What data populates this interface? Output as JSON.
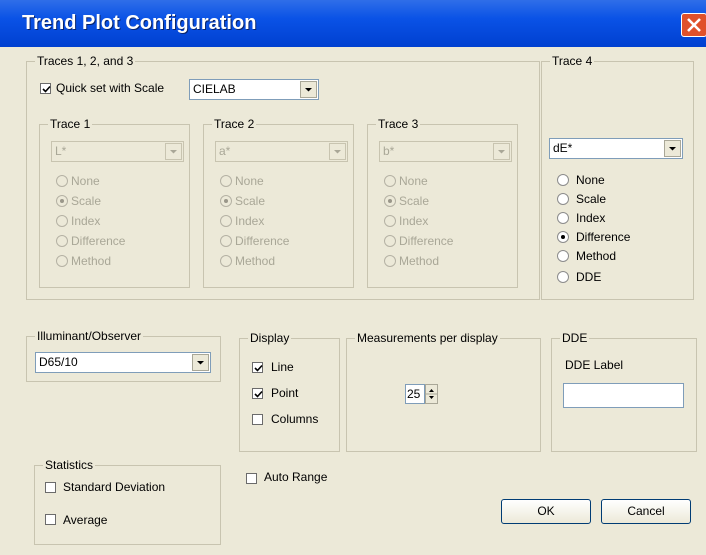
{
  "window": {
    "title": "Trend Plot Configuration"
  },
  "traces123": {
    "group_label": "Traces 1, 2, and 3",
    "quick_set_label": "Quick set with Scale",
    "quick_set_checked": true,
    "scale_value": "CIELAB",
    "traces": [
      {
        "label": "Trace 1",
        "value": "L*",
        "selected": "Scale"
      },
      {
        "label": "Trace 2",
        "value": "a*",
        "selected": "Scale"
      },
      {
        "label": "Trace 3",
        "value": "b*",
        "selected": "Scale"
      }
    ],
    "options": [
      "None",
      "Scale",
      "Index",
      "Difference",
      "Method"
    ]
  },
  "trace4": {
    "label": "Trace 4",
    "value": "dE*",
    "options": [
      "None",
      "Scale",
      "Index",
      "Difference",
      "Method",
      "DDE"
    ],
    "selected": "Difference"
  },
  "illuminant": {
    "label": "Illuminant/Observer",
    "value": "D65/10"
  },
  "display": {
    "label": "Display",
    "line": {
      "label": "Line",
      "checked": true
    },
    "point": {
      "label": "Point",
      "checked": true
    },
    "columns": {
      "label": "Columns",
      "checked": false
    }
  },
  "measurements": {
    "label": "Measurements per display",
    "value": "25"
  },
  "dde": {
    "label": "DDE",
    "dde_label": "DDE Label",
    "value": ""
  },
  "statistics": {
    "label": "Statistics",
    "std_dev": {
      "label": "Standard Deviation",
      "checked": false
    },
    "average": {
      "label": "Average",
      "checked": false
    }
  },
  "auto_range": {
    "label": "Auto Range",
    "checked": false
  },
  "buttons": {
    "ok": "OK",
    "cancel": "Cancel"
  }
}
